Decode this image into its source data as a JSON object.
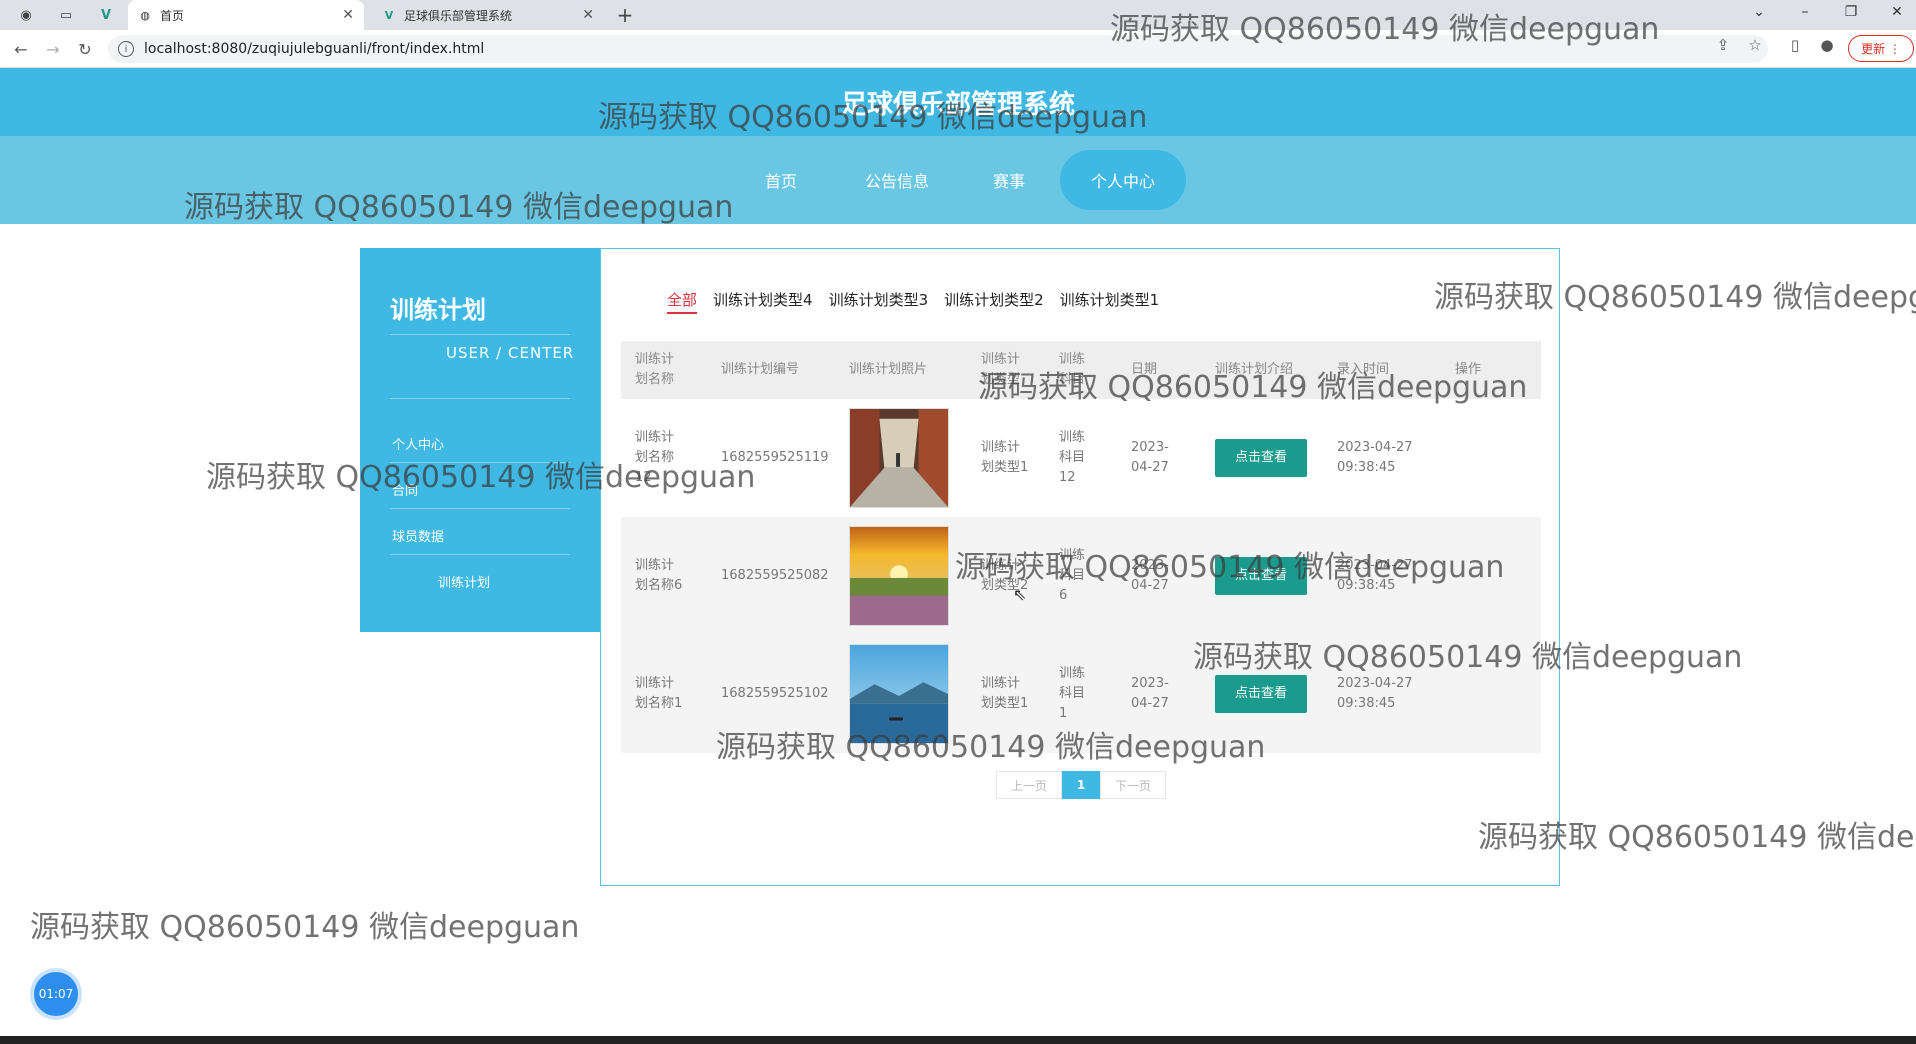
{
  "browser": {
    "tabs": [
      {
        "label": "首页",
        "icon": "globe-icon"
      },
      {
        "label": "足球俱乐部管理系统",
        "icon": "vue-logo-icon"
      }
    ],
    "url": "localhost:8080/zuqiujulebguanli/front/index.html",
    "update_label": "更新"
  },
  "site": {
    "title": "足球俱乐部管理系统",
    "nav": [
      "首页",
      "公告信息",
      "赛事",
      "个人中心"
    ],
    "active_nav": "个人中心"
  },
  "sidebar": {
    "title": "训练计划",
    "subtitle": "USER / CENTER",
    "items": [
      "个人中心",
      "合同",
      "球员数据",
      "训练计划"
    ]
  },
  "filters": {
    "items": [
      "全部",
      "训练计划类型4",
      "训练计划类型3",
      "训练计划类型2",
      "训练计划类型1"
    ],
    "active": "全部"
  },
  "table": {
    "headers": [
      "训练计划名称",
      "训练计划编号",
      "训练计划照片",
      "训练计划类型",
      "训练科目",
      "日期",
      "训练计划介绍",
      "录入时间",
      "操作"
    ],
    "rows": [
      {
        "name": "训练计划名称12",
        "code": "1682559525119",
        "type": "训练计划类型1",
        "subject": "训练科目12",
        "date": "2023-04-27",
        "action": "点击查看",
        "created": "2023-04-27 09:38:45",
        "photo": "corridor"
      },
      {
        "name": "训练计划名称6",
        "code": "1682559525082",
        "type": "训练计划类型2",
        "subject": "训练科目6",
        "date": "2023-04-27",
        "action": "点击查看",
        "created": "2023-04-27 09:38:45",
        "photo": "sunset-field"
      },
      {
        "name": "训练计划名称1",
        "code": "1682559525102",
        "type": "训练计划类型1",
        "subject": "训练科目1",
        "date": "2023-04-27",
        "action": "点击查看",
        "created": "2023-04-27 09:38:45",
        "photo": "lake"
      }
    ]
  },
  "pager": {
    "prev": "上一页",
    "current": "1",
    "next": "下一页"
  },
  "timer": "01:07",
  "watermark": "源码获取 QQ86050149 微信deepguan",
  "colors": {
    "primary": "#3fb8e3",
    "nav": "#6ac7e3",
    "button": "#1a9b8d",
    "active_filter": "#d9363e"
  }
}
